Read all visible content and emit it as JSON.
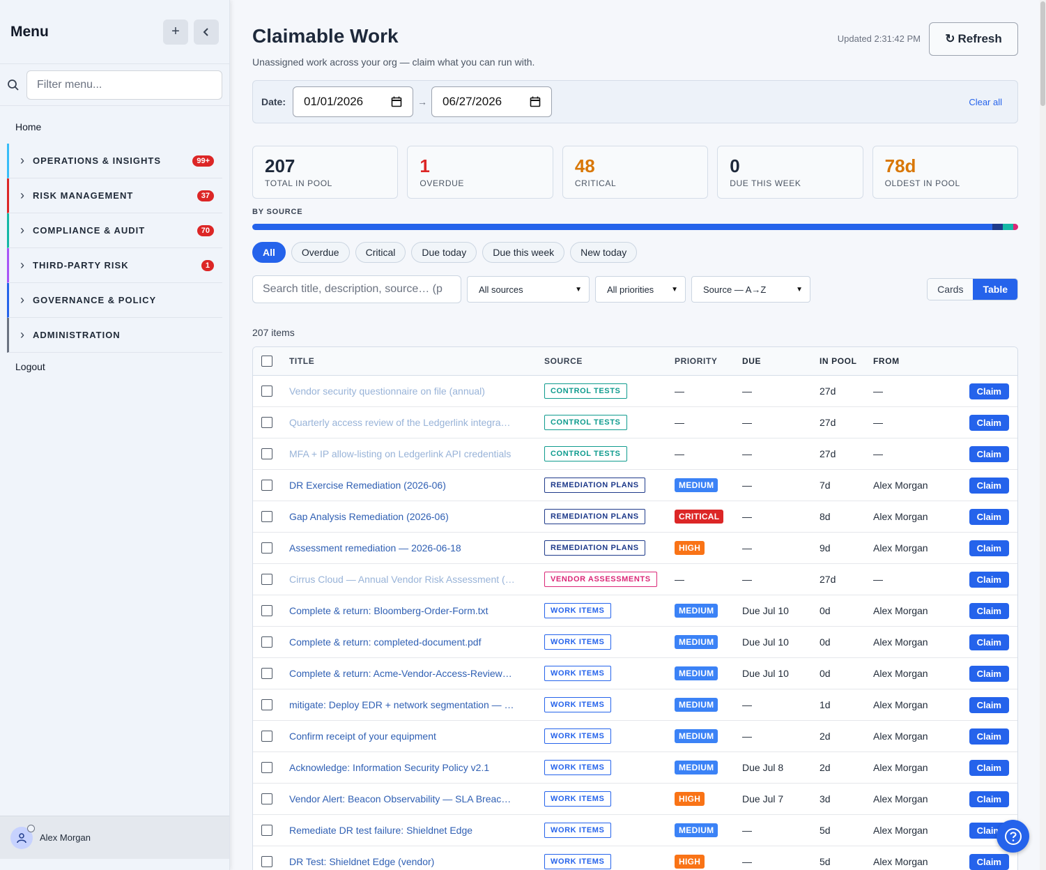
{
  "sidebar": {
    "title": "Menu",
    "add_icon": "plus-icon",
    "collapse_icon": "chevron-left-icon",
    "filter_placeholder": "Filter menu...",
    "home": "Home",
    "items": [
      {
        "label": "OPERATIONS & INSIGHTS",
        "badge": "99+",
        "color": "#38bdf8"
      },
      {
        "label": "RISK MANAGEMENT",
        "badge": "37",
        "color": "#dc2626"
      },
      {
        "label": "COMPLIANCE & AUDIT",
        "badge": "70",
        "color": "#14b8a6"
      },
      {
        "label": "THIRD-PARTY RISK",
        "badge": "1",
        "color": "#a855f7"
      },
      {
        "label": "GOVERNANCE & POLICY",
        "badge": "",
        "color": "#2563eb"
      },
      {
        "label": "ADMINISTRATION",
        "badge": "",
        "color": "#6b7280"
      }
    ],
    "logout": "Logout",
    "user_name": "Alex Morgan"
  },
  "header": {
    "title": "Claimable Work",
    "subtitle": "Unassigned work across your org — claim what you can run with.",
    "updated": "Updated 2:31:42 PM",
    "refresh_label": "Refresh"
  },
  "date_filter": {
    "label": "Date:",
    "from": "01/01/2026",
    "arrow": "→",
    "to": "06/27/2026",
    "clear_label": "Clear all"
  },
  "stats": [
    {
      "value": "207",
      "label": "TOTAL IN POOL",
      "color": "#1e293b"
    },
    {
      "value": "1",
      "label": "OVERDUE",
      "color": "#dc2626"
    },
    {
      "value": "48",
      "label": "CRITICAL",
      "color": "#d97706"
    },
    {
      "value": "0",
      "label": "DUE THIS WEEK",
      "color": "#1e293b"
    },
    {
      "value": "78d",
      "label": "OLDEST IN POOL",
      "color": "#d97706"
    }
  ],
  "by_source": {
    "label": "BY SOURCE",
    "segments": [
      {
        "fraction": 0.966,
        "color": "#2563eb"
      },
      {
        "fraction": 0.014,
        "color": "#1e3a8a"
      },
      {
        "fraction": 0.014,
        "color": "#14b8a6"
      },
      {
        "fraction": 0.006,
        "color": "#db2777"
      }
    ]
  },
  "chips": [
    {
      "label": "All",
      "active": true
    },
    {
      "label": "Overdue",
      "active": false
    },
    {
      "label": "Critical",
      "active": false
    },
    {
      "label": "Due today",
      "active": false
    },
    {
      "label": "Due this week",
      "active": false
    },
    {
      "label": "New today",
      "active": false
    }
  ],
  "filters": {
    "search_placeholder": "Search title, description, source… (p",
    "source": "All sources",
    "priority": "All priorities",
    "sort": "Source — A→Z",
    "view_cards": "Cards",
    "view_table": "Table"
  },
  "item_count": "207 items",
  "table": {
    "columns": {
      "title": "TITLE",
      "source": "SOURCE",
      "priority": "PRIORITY",
      "due": "DUE",
      "pool": "IN POOL",
      "from": "FROM"
    },
    "claim_label": "Claim",
    "rows": [
      {
        "title": "Vendor security questionnaire on file (annual)",
        "muted": true,
        "source": "CONTROL TESTS",
        "priority": "—",
        "due": "—",
        "pool": "27d",
        "from": "—"
      },
      {
        "title": "Quarterly access review of the Ledgerlink integra…",
        "muted": true,
        "source": "CONTROL TESTS",
        "priority": "—",
        "due": "—",
        "pool": "27d",
        "from": "—"
      },
      {
        "title": "MFA + IP allow-listing on Ledgerlink API credentials",
        "muted": true,
        "source": "CONTROL TESTS",
        "priority": "—",
        "due": "—",
        "pool": "27d",
        "from": "—"
      },
      {
        "title": "DR Exercise Remediation (2026-06)",
        "muted": false,
        "source": "REMEDIATION PLANS",
        "priority": "MEDIUM",
        "due": "—",
        "pool": "7d",
        "from": "Alex Morgan"
      },
      {
        "title": "Gap Analysis Remediation (2026-06)",
        "muted": false,
        "source": "REMEDIATION PLANS",
        "priority": "CRITICAL",
        "due": "—",
        "pool": "8d",
        "from": "Alex Morgan"
      },
      {
        "title": "Assessment remediation — 2026-06-18",
        "muted": false,
        "source": "REMEDIATION PLANS",
        "priority": "HIGH",
        "due": "—",
        "pool": "9d",
        "from": "Alex Morgan"
      },
      {
        "title": "Cirrus Cloud — Annual Vendor Risk Assessment (…",
        "muted": true,
        "source": "VENDOR ASSESSMENTS",
        "priority": "—",
        "due": "—",
        "pool": "27d",
        "from": "—"
      },
      {
        "title": "Complete & return: Bloomberg-Order-Form.txt",
        "muted": false,
        "source": "WORK ITEMS",
        "priority": "MEDIUM",
        "due": "Due Jul 10",
        "pool": "0d",
        "from": "Alex Morgan"
      },
      {
        "title": "Complete & return: completed-document.pdf",
        "muted": false,
        "source": "WORK ITEMS",
        "priority": "MEDIUM",
        "due": "Due Jul 10",
        "pool": "0d",
        "from": "Alex Morgan"
      },
      {
        "title": "Complete & return: Acme-Vendor-Access-Review…",
        "muted": false,
        "source": "WORK ITEMS",
        "priority": "MEDIUM",
        "due": "Due Jul 10",
        "pool": "0d",
        "from": "Alex Morgan"
      },
      {
        "title": "mitigate: Deploy EDR + network segmentation — …",
        "muted": false,
        "source": "WORK ITEMS",
        "priority": "MEDIUM",
        "due": "—",
        "pool": "1d",
        "from": "Alex Morgan"
      },
      {
        "title": "Confirm receipt of your equipment",
        "muted": false,
        "source": "WORK ITEMS",
        "priority": "MEDIUM",
        "due": "—",
        "pool": "2d",
        "from": "Alex Morgan"
      },
      {
        "title": "Acknowledge: Information Security Policy v2.1",
        "muted": false,
        "source": "WORK ITEMS",
        "priority": "MEDIUM",
        "due": "Due Jul 8",
        "pool": "2d",
        "from": "Alex Morgan"
      },
      {
        "title": "Vendor Alert: Beacon Observability — SLA Breac…",
        "muted": false,
        "source": "WORK ITEMS",
        "priority": "HIGH",
        "due": "Due Jul 7",
        "pool": "3d",
        "from": "Alex Morgan"
      },
      {
        "title": "Remediate DR test failure: Shieldnet Edge",
        "muted": false,
        "source": "WORK ITEMS",
        "priority": "MEDIUM",
        "due": "—",
        "pool": "5d",
        "from": "Alex Morgan"
      },
      {
        "title": "DR Test: Shieldnet Edge (vendor)",
        "muted": false,
        "source": "WORK ITEMS",
        "priority": "HIGH",
        "due": "—",
        "pool": "5d",
        "from": "Alex Morgan"
      }
    ]
  },
  "source_colors": {
    "CONTROL TESTS": "#0f9b8e",
    "REMEDIATION PLANS": "#1e3a8a",
    "VENDOR ASSESSMENTS": "#db2777",
    "WORK ITEMS": "#2563eb"
  },
  "priority_colors": {
    "MEDIUM": "#3b82f6",
    "CRITICAL": "#dc2626",
    "HIGH": "#f97316"
  },
  "help_icon": "help-circle-icon"
}
